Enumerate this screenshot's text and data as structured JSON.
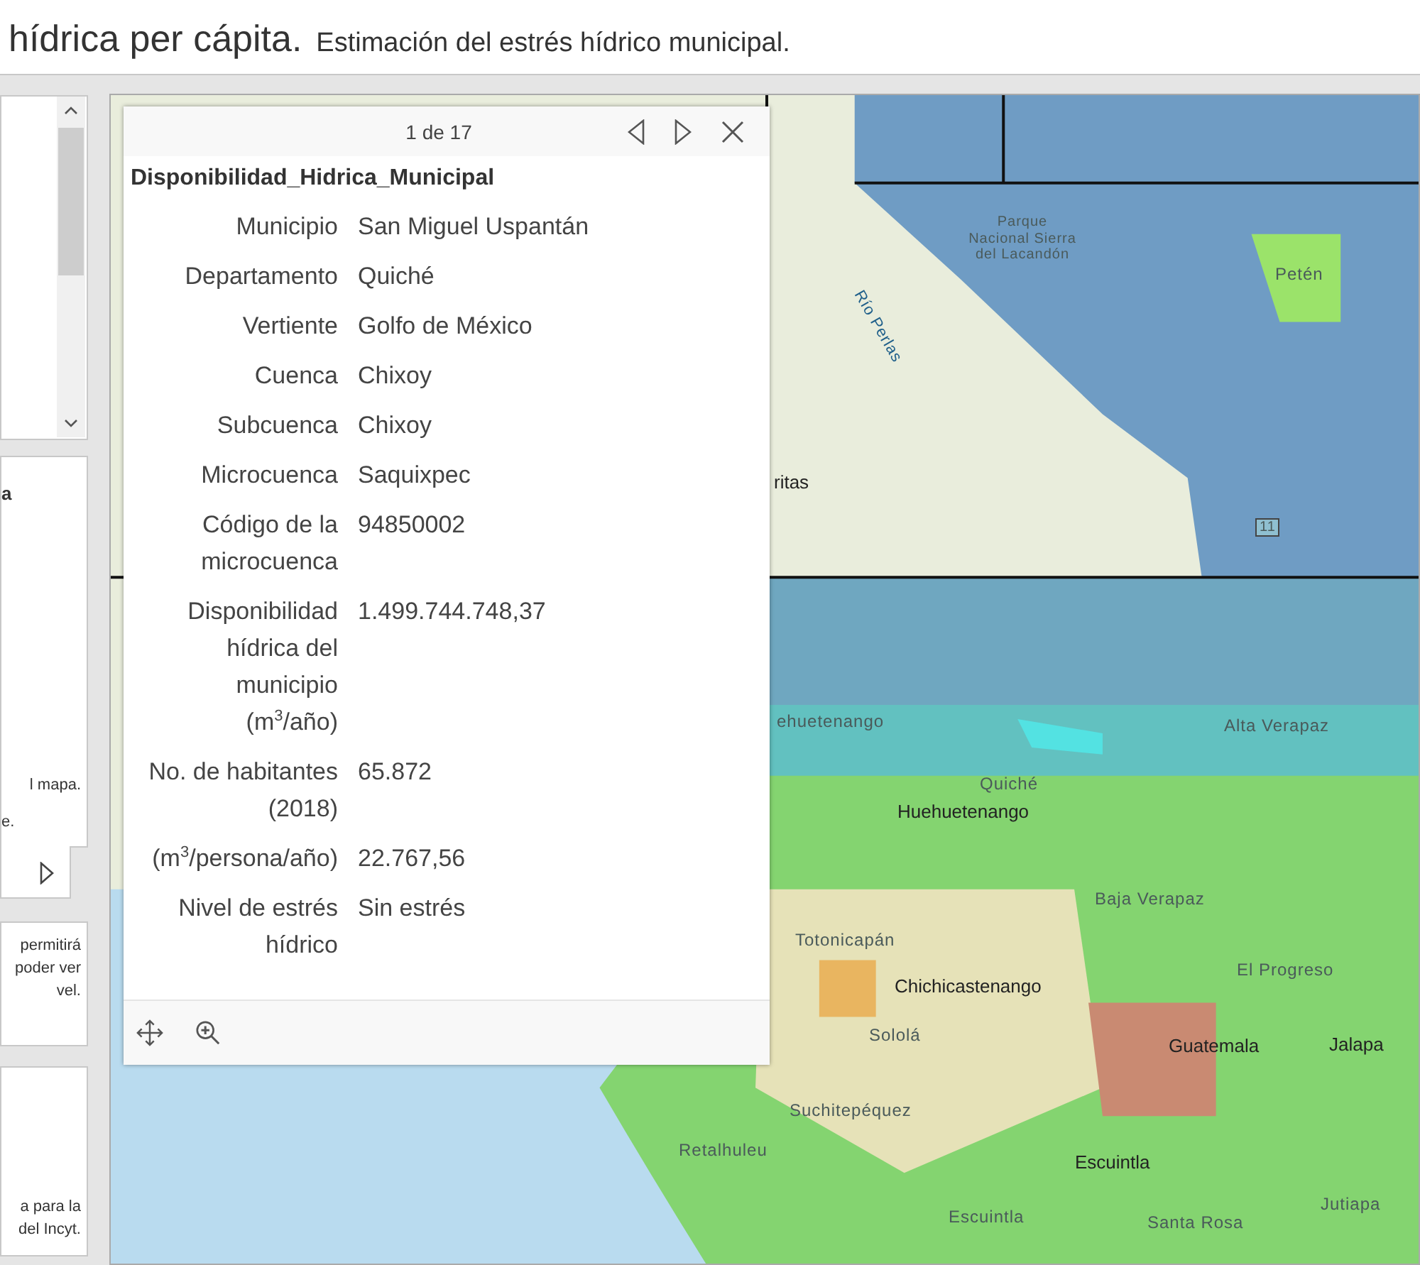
{
  "header": {
    "title": "hídrica per cápita.",
    "subtitle": "Estimación del estrés hídrico municipal."
  },
  "side_panels": [
    {
      "texts": [
        "a",
        "l mapa.",
        "e."
      ]
    },
    {
      "texts": [
        "permitirá",
        "poder ver",
        "vel."
      ]
    },
    {
      "texts": [
        "a para la",
        "del Incyt."
      ]
    }
  ],
  "popup": {
    "counter": "1 de 17",
    "layer_title": "Disponibilidad_Hidrica_Municipal",
    "fields": [
      {
        "label": "Municipio",
        "value": "San Miguel Uspantán"
      },
      {
        "label": "Departamento",
        "value": "Quiché"
      },
      {
        "label": "Vertiente",
        "value": "Golfo de México"
      },
      {
        "label": "Cuenca",
        "value": "Chixoy"
      },
      {
        "label": "Subcuenca",
        "value": "Chixoy"
      },
      {
        "label": "Microcuenca",
        "value": "Saquixpec"
      },
      {
        "label": "Código de la microcuenca",
        "value": "94850002"
      },
      {
        "label": "Disponibilidad hídrica del municipio (m$^{3}$/año)",
        "value": "1.499.744.748,37"
      },
      {
        "label": "No. de habitantes (2018)",
        "value": "65.872"
      },
      {
        "label": "(m$^{3}$/persona/año)",
        "value": "22.767,56"
      },
      {
        "label": "Nivel de estrés hídrico",
        "value": "Sin estrés"
      }
    ]
  },
  "map_labels": [
    {
      "text": "Parque Nacional Sierra del Lacandón",
      "kind": "park"
    },
    {
      "text": "Petén",
      "kind": "region"
    },
    {
      "text": "Río Perlas",
      "kind": "river"
    },
    {
      "text": "ritas",
      "kind": "town"
    },
    {
      "text": "11",
      "kind": "road"
    },
    {
      "text": "Alta Verapaz",
      "kind": "region"
    },
    {
      "text": "ehuetenango",
      "kind": "region"
    },
    {
      "text": "Quiché",
      "kind": "region"
    },
    {
      "text": "Huehuetenango",
      "kind": "town"
    },
    {
      "text": "Baja Verapaz",
      "kind": "region"
    },
    {
      "text": "Totonicapán",
      "kind": "region"
    },
    {
      "text": "El Progreso",
      "kind": "region"
    },
    {
      "text": "Chichicastenango",
      "kind": "town"
    },
    {
      "text": "Sololá",
      "kind": "region"
    },
    {
      "text": "Guatemala",
      "kind": "town"
    },
    {
      "text": "Jalapa",
      "kind": "town"
    },
    {
      "text": "Suchitepéquez",
      "kind": "region"
    },
    {
      "text": "Retalhuleu",
      "kind": "region"
    },
    {
      "text": "Escuintla",
      "kind": "town"
    },
    {
      "text": "Escuintla",
      "kind": "region"
    },
    {
      "text": "Santa Rosa",
      "kind": "region"
    },
    {
      "text": "Jutiapa",
      "kind": "region"
    }
  ]
}
